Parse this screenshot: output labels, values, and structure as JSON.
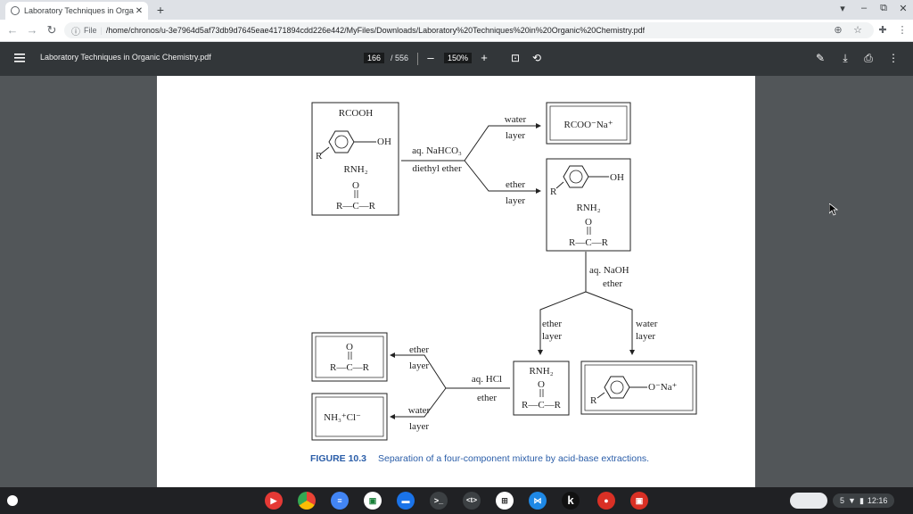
{
  "browser": {
    "tab_title": "Laboratory Techniques in Organ",
    "tab_close": "✕",
    "new_tab": "+",
    "window_controls": [
      "▾",
      "–",
      "⧉",
      "✕"
    ],
    "omnibox": {
      "chip": "File",
      "url": "/home/chronos/u-3e7964d5af73db9d7645eae4171894cdd226e442/MyFiles/Downloads/Laboratory%20Techniques%20in%20Organic%20Chemistry.pdf"
    }
  },
  "pdf_toolbar": {
    "file_name": "Laboratory Techniques in Organic Chemistry.pdf",
    "current_page": "166",
    "total_pages": "/ 556",
    "zoom": "150%",
    "zoom_out": "–",
    "zoom_in": "+"
  },
  "figure": {
    "box1": {
      "acid": "RCOOH",
      "oh": "OH",
      "r": "R",
      "amine": "RNH₂",
      "o": "O",
      "ketone": "R—C—R"
    },
    "step1": {
      "reagent": "aq. NaHCO₃",
      "solvent": "diethyl ether"
    },
    "branch1_water": {
      "label1": "water",
      "label2": "layer"
    },
    "branch1_ether": {
      "label1": "ether",
      "label2": "layer"
    },
    "box_salt": "RCOO⁻Na⁺",
    "box2": {
      "oh": "OH",
      "r": "R",
      "amine": "RNH₂",
      "o": "O",
      "ketone": "R—C—R"
    },
    "step2": {
      "reagent": "aq. NaOH",
      "solvent": "ether"
    },
    "branch2_ether": {
      "label1": "ether",
      "label2": "layer"
    },
    "branch2_water": {
      "label1": "water",
      "label2": "layer"
    },
    "box3": {
      "amine": "RNH₂",
      "o": "O",
      "ketone": "R—C—R"
    },
    "box_phenoxide": {
      "o": "O⁻Na⁺",
      "r": "R"
    },
    "step3": {
      "reagent": "aq. HCl",
      "solvent": "ether"
    },
    "branch3_ether": {
      "label1": "ether",
      "label2": "layer"
    },
    "branch3_water": {
      "label1": "water",
      "label2": "layer"
    },
    "box_ketone": {
      "o": "O",
      "ketone": "R—C—R"
    },
    "box_ammonium": "NH₃⁺Cl⁻",
    "caption_label": "FIGURE 10.3",
    "caption_text": "Separation of a four-component mixture by acid-base extractions."
  },
  "shelf": {
    "apps": [
      "YouTube",
      "Chrome",
      "Docs",
      "Meet",
      "Files",
      "Terminal",
      "Text",
      "Linux",
      "VS Code",
      "K",
      "Recorder",
      "Screencast"
    ],
    "app_glyphs": [
      "▶",
      "",
      "≡",
      "▣",
      "▬",
      ">_",
      "<t>",
      "⊞",
      "⋈",
      "k",
      "●",
      "▣"
    ],
    "notifications": "5",
    "time": "12:16"
  }
}
